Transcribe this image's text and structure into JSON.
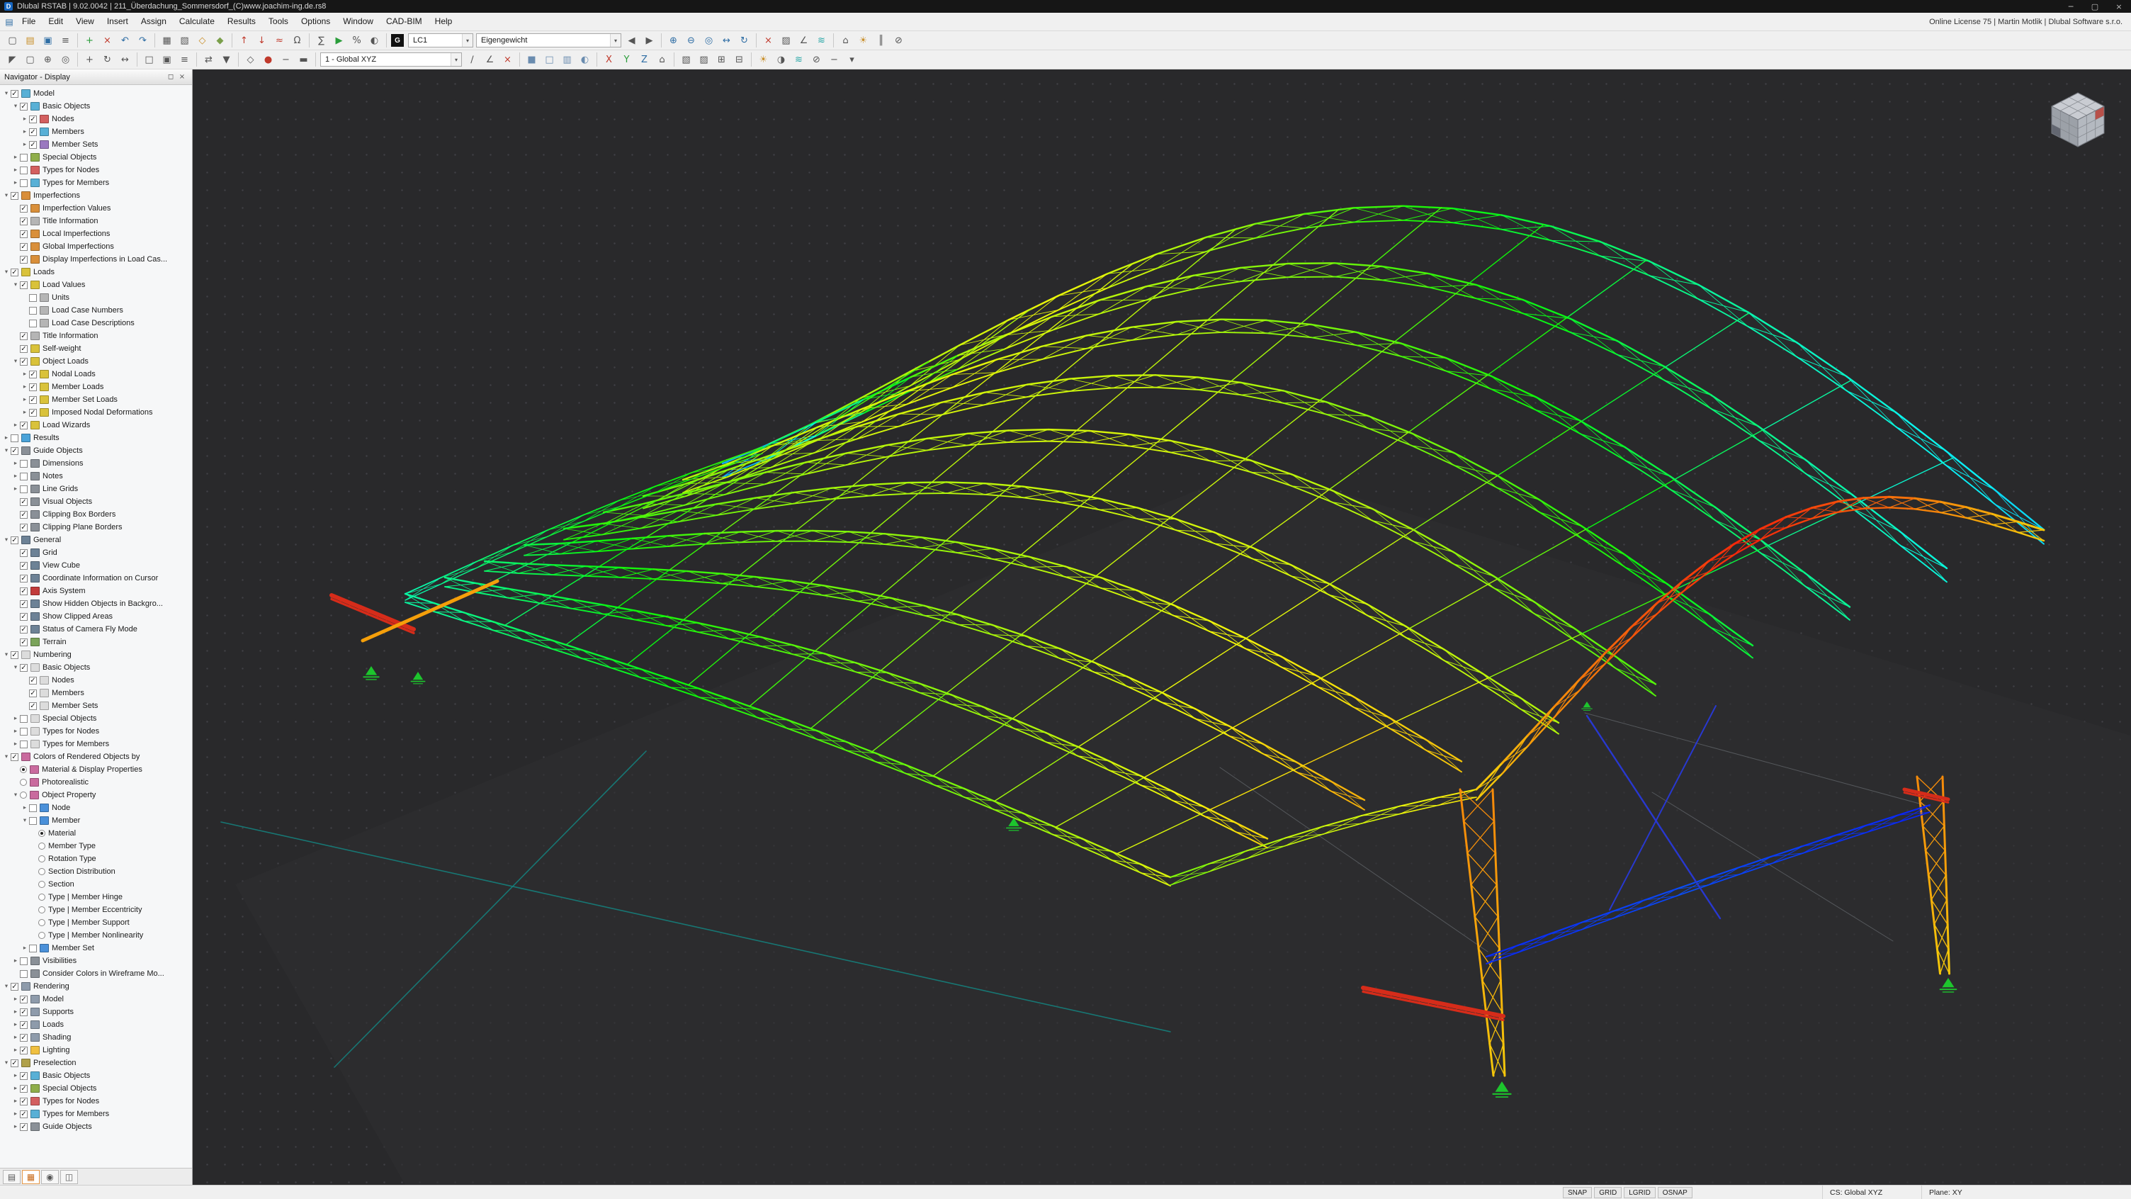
{
  "window": {
    "title": "Dlubal RSTAB | 9.02.0042 | 211_Überdachung_Sommersdorf_(C)www.joachim-ing.de.rs8",
    "license": "Online License 75 | Martin Motlik | Dlubal Software s.r.o.",
    "app_initial": "D",
    "minimize": "─",
    "maximize": "▢",
    "close": "×"
  },
  "menu": {
    "items": [
      "File",
      "Edit",
      "View",
      "Insert",
      "Assign",
      "Calculate",
      "Results",
      "Tools",
      "Options",
      "Window",
      "CAD-BIM",
      "Help"
    ]
  },
  "toolbar1": {
    "lc_tag": "G",
    "load_case": "LC1",
    "load_case_name": "Eigengewicht",
    "icons_a": [
      [
        "▢",
        "#555",
        "new-model"
      ],
      [
        "▤",
        "#c98f2a",
        "open-file"
      ],
      [
        "▣",
        "#2e6da4",
        "save"
      ],
      [
        "≡",
        "#555",
        "print"
      ],
      "|",
      [
        "+",
        "#2a9d3a",
        "add-object"
      ],
      [
        "×",
        "#c0392b",
        "delete-object"
      ],
      [
        "↶",
        "#2e6da4",
        "undo"
      ],
      [
        "↷",
        "#2e6da4",
        "redo"
      ],
      "|",
      [
        "▦",
        "#555",
        "tables"
      ],
      [
        "▧",
        "#555",
        "spreadsheet"
      ],
      [
        "◇",
        "#c98f2a",
        "materials"
      ],
      [
        "◆",
        "#7a9f4a",
        "sections"
      ],
      "|",
      [
        "↑",
        "#c0392b",
        "nodal-load"
      ],
      [
        "↓",
        "#c0392b",
        "member-load"
      ],
      [
        "≈",
        "#c0392b",
        "line-load"
      ],
      [
        "Ω",
        "#555",
        "imperfections"
      ],
      "|",
      [
        "∑",
        "#555",
        "load-combinations"
      ],
      [
        "▶",
        "#2a9d3a",
        "calculate-all"
      ],
      [
        "%",
        "#555",
        "calculation-parameters"
      ],
      [
        "◐",
        "#555",
        "results-toggle"
      ],
      "|"
    ],
    "icons_b": [
      [
        "◀",
        "#555",
        "previous-load-case"
      ],
      [
        "▶",
        "#555",
        "next-load-case"
      ],
      "|",
      [
        "⊕",
        "#2e6da4",
        "zoom-in"
      ],
      [
        "⊖",
        "#2e6da4",
        "zoom-out"
      ],
      [
        "◎",
        "#2e6da4",
        "zoom-extents"
      ],
      [
        "↔",
        "#2e6da4",
        "pan-view"
      ],
      [
        "↻",
        "#2e6da4",
        "rotate-view"
      ],
      "|",
      [
        "×",
        "#c0392b",
        "stop-calculation"
      ],
      [
        "▨",
        "#555",
        "result-diagrams"
      ],
      [
        "∠",
        "#555",
        "dimensioning"
      ],
      [
        "≋",
        "#2aa7a7",
        "deformations"
      ],
      "|",
      [
        "⌂",
        "#555",
        "home-view"
      ],
      [
        "☀",
        "#c98f2a",
        "lighting"
      ],
      [
        "║",
        "#555",
        "section-cut"
      ],
      [
        "⊘",
        "#555",
        "hide-objects"
      ]
    ]
  },
  "toolbar2": {
    "coordinate_system": "1 - Global XYZ",
    "icons_a": [
      [
        "◤",
        "#555",
        "select-pointer"
      ],
      [
        "▢",
        "#555",
        "box-select"
      ],
      [
        "⊕",
        "#555",
        "snap-settings"
      ],
      [
        "◎",
        "#555",
        "center-view"
      ],
      "|",
      [
        "+",
        "#555",
        "move-copy"
      ],
      [
        "↻",
        "#555",
        "rotate-copy"
      ],
      [
        "↔",
        "#555",
        "mirror"
      ],
      "|",
      [
        "□",
        "#555",
        "wireframe-mode"
      ],
      [
        "▣",
        "#555",
        "solid-mode"
      ],
      [
        "≡",
        "#555",
        "display-properties"
      ],
      "|",
      [
        "⇄",
        "#555",
        "toggle-tables"
      ],
      [
        "▼",
        "#555",
        "table-down"
      ],
      "|",
      [
        "◇",
        "#555",
        "points"
      ],
      [
        "●",
        "#c0392b",
        "nodes-display"
      ],
      [
        "−",
        "#555",
        "lines-display"
      ],
      [
        "▬",
        "#555",
        "members-display"
      ],
      "|"
    ],
    "icons_b": [
      [
        "∕",
        "#555",
        "draw-line"
      ],
      [
        "∠",
        "#555",
        "measure"
      ],
      [
        "×",
        "#c0392b",
        "delete"
      ],
      "|",
      [
        "■",
        "#6a8caf",
        "render-solid"
      ],
      [
        "□",
        "#6a8caf",
        "render-wireframe"
      ],
      [
        "▥",
        "#6a8caf",
        "render-hidden-line"
      ],
      [
        "◐",
        "#6a8caf",
        "render-shaded"
      ],
      "|",
      [
        "X",
        "#c0392b",
        "view-x"
      ],
      [
        "Y",
        "#2a9d3a",
        "view-y"
      ],
      [
        "Z",
        "#2e6da4",
        "view-z"
      ],
      [
        "⌂",
        "#555",
        "isometric-view"
      ],
      "|",
      [
        "▧",
        "#555",
        "clipping-box"
      ],
      [
        "▨",
        "#555",
        "clipping-plane"
      ],
      [
        "⊞",
        "#555",
        "grid-toggle"
      ],
      [
        "⊟",
        "#555",
        "work-plane"
      ],
      "|",
      [
        "☀",
        "#c98f2a",
        "light-toggle"
      ],
      [
        "◑",
        "#555",
        "shadow-toggle"
      ],
      [
        "≋",
        "#2aa7a7",
        "color-scale"
      ],
      [
        "⊘",
        "#555",
        "visibility-filter"
      ],
      [
        "−",
        "#555",
        "minimize-panel"
      ],
      [
        "▾",
        "#555",
        "more-options"
      ]
    ]
  },
  "navigator": {
    "title": "Navigator - Display",
    "pin_icon": "◻",
    "close_icon": "×",
    "tabs": [
      {
        "g": "▤",
        "n": "tab-data",
        "active": false
      },
      {
        "g": "▦",
        "n": "tab-display",
        "active": true
      },
      {
        "g": "◉",
        "n": "tab-views",
        "active": false
      },
      {
        "g": "◫",
        "n": "tab-results",
        "active": false
      }
    ],
    "tree": [
      [
        "Model",
        0,
        2,
        "c1",
        "#58b0d6"
      ],
      [
        "Basic Objects",
        1,
        2,
        "c1",
        "#58b0d6"
      ],
      [
        "Nodes",
        2,
        1,
        "c1",
        "#d35f5f"
      ],
      [
        "Members",
        2,
        1,
        "c1",
        "#58b0d6"
      ],
      [
        "Member Sets",
        2,
        1,
        "c1",
        "#9a78c0"
      ],
      [
        "Special Objects",
        1,
        1,
        "c0",
        "#8fae4a"
      ],
      [
        "Types for Nodes",
        1,
        1,
        "c0",
        "#d35f5f"
      ],
      [
        "Types for Members",
        1,
        1,
        "c0",
        "#58b0d6"
      ],
      [
        "Imperfections",
        0,
        2,
        "c1",
        "#d98f3a"
      ],
      [
        "Imperfection Values",
        1,
        0,
        "c1",
        "#d98f3a"
      ],
      [
        "Title Information",
        1,
        0,
        "c1",
        "#b5b5b5"
      ],
      [
        "Local Imperfections",
        1,
        0,
        "c1",
        "#d98f3a"
      ],
      [
        "Global Imperfections",
        1,
        0,
        "c1",
        "#d98f3a"
      ],
      [
        "Display Imperfections in Load Cas...",
        1,
        0,
        "c1",
        "#d98f3a"
      ],
      [
        "Loads",
        0,
        2,
        "c1",
        "#d9c23a"
      ],
      [
        "Load Values",
        1,
        2,
        "c1",
        "#d9c23a"
      ],
      [
        "Units",
        2,
        0,
        "c0",
        "#b5b5b5"
      ],
      [
        "Load Case Numbers",
        2,
        0,
        "c0",
        "#b5b5b5"
      ],
      [
        "Load Case Descriptions",
        2,
        0,
        "c0",
        "#b5b5b5"
      ],
      [
        "Title Information",
        1,
        0,
        "c1",
        "#b5b5b5"
      ],
      [
        "Self-weight",
        1,
        0,
        "c1",
        "#d9c23a"
      ],
      [
        "Object Loads",
        1,
        2,
        "c1",
        "#d9c23a"
      ],
      [
        "Nodal Loads",
        2,
        1,
        "c1",
        "#d9c23a"
      ],
      [
        "Member Loads",
        2,
        1,
        "c1",
        "#d9c23a"
      ],
      [
        "Member Set Loads",
        2,
        1,
        "c1",
        "#d9c23a"
      ],
      [
        "Imposed Nodal Deformations",
        2,
        1,
        "c1",
        "#d9c23a"
      ],
      [
        "Load Wizards",
        1,
        1,
        "c1",
        "#d9c23a"
      ],
      [
        "Results",
        0,
        1,
        "c0",
        "#4aa3d9"
      ],
      [
        "Guide Objects",
        0,
        2,
        "c1",
        "#8a9097"
      ],
      [
        "Dimensions",
        1,
        1,
        "c0",
        "#8a9097"
      ],
      [
        "Notes",
        1,
        1,
        "c0",
        "#8a9097"
      ],
      [
        "Line Grids",
        1,
        1,
        "c0",
        "#8a9097"
      ],
      [
        "Visual Objects",
        1,
        0,
        "c1",
        "#8a9097"
      ],
      [
        "Clipping Box Borders",
        1,
        0,
        "c1",
        "#8a9097"
      ],
      [
        "Clipping Plane Borders",
        1,
        0,
        "c1",
        "#8a9097"
      ],
      [
        "General",
        0,
        2,
        "c1",
        "#6d8296"
      ],
      [
        "Grid",
        1,
        0,
        "c1",
        "#6d8296"
      ],
      [
        "View Cube",
        1,
        0,
        "c1",
        "#6d8296"
      ],
      [
        "Coordinate Information on Cursor",
        1,
        0,
        "c1",
        "#6d8296"
      ],
      [
        "Axis System",
        1,
        0,
        "c1",
        "#c23b3b"
      ],
      [
        "Show Hidden Objects in Backgro...",
        1,
        0,
        "c1",
        "#6d8296"
      ],
      [
        "Show Clipped Areas",
        1,
        0,
        "c1",
        "#6d8296"
      ],
      [
        "Status of Camera Fly Mode",
        1,
        0,
        "c1",
        "#6d8296"
      ],
      [
        "Terrain",
        1,
        0,
        "c1",
        "#7aa35a"
      ],
      [
        "Numbering",
        0,
        2,
        "c1",
        "#dcdcdc"
      ],
      [
        "Basic Objects",
        1,
        2,
        "c1",
        "#dcdcdc"
      ],
      [
        "Nodes",
        2,
        0,
        "c1",
        "#dcdcdc"
      ],
      [
        "Members",
        2,
        0,
        "c1",
        "#dcdcdc"
      ],
      [
        "Member Sets",
        2,
        0,
        "c1",
        "#dcdcdc"
      ],
      [
        "Special Objects",
        1,
        1,
        "c0",
        "#dcdcdc"
      ],
      [
        "Types for Nodes",
        1,
        1,
        "c0",
        "#dcdcdc"
      ],
      [
        "Types for Members",
        1,
        1,
        "c0",
        "#dcdcdc"
      ],
      [
        "Colors of Rendered Objects by",
        0,
        2,
        "c1",
        "#c96a9e"
      ],
      [
        "Material & Display Properties",
        1,
        0,
        "r1",
        "#c96a9e"
      ],
      [
        "Photorealistic",
        1,
        0,
        "r0",
        "#c96a9e"
      ],
      [
        "Object Property",
        1,
        2,
        "r0",
        "#c96a9e"
      ],
      [
        "Node",
        2,
        1,
        "c0",
        "#4a90d9"
      ],
      [
        "Member",
        2,
        2,
        "c0",
        "#4a90d9"
      ],
      [
        "Material",
        3,
        0,
        "r1",
        null
      ],
      [
        "Member Type",
        3,
        0,
        "r0",
        null
      ],
      [
        "Rotation Type",
        3,
        0,
        "r0",
        null
      ],
      [
        "Section Distribution",
        3,
        0,
        "r0",
        null
      ],
      [
        "Section",
        3,
        0,
        "r0",
        null
      ],
      [
        "Type | Member Hinge",
        3,
        0,
        "r0",
        null
      ],
      [
        "Type | Member Eccentricity",
        3,
        0,
        "r0",
        null
      ],
      [
        "Type | Member Support",
        3,
        0,
        "r0",
        null
      ],
      [
        "Type | Member Nonlinearity",
        3,
        0,
        "r0",
        null
      ],
      [
        "Member Set",
        2,
        1,
        "c0",
        "#4a90d9"
      ],
      [
        "Visibilities",
        1,
        1,
        "c0",
        "#8a9097"
      ],
      [
        "Consider Colors in Wireframe Mo...",
        1,
        0,
        "c0",
        "#8a9097"
      ],
      [
        "Rendering",
        0,
        2,
        "c1",
        "#8e9bab"
      ],
      [
        "Model",
        1,
        1,
        "c1",
        "#8e9bab"
      ],
      [
        "Supports",
        1,
        1,
        "c1",
        "#8e9bab"
      ],
      [
        "Loads",
        1,
        1,
        "c1",
        "#8e9bab"
      ],
      [
        "Shading",
        1,
        1,
        "c1",
        "#8e9bab"
      ],
      [
        "Lighting",
        1,
        1,
        "c1",
        "#f0c040"
      ],
      [
        "Preselection",
        0,
        2,
        "c1",
        "#b0a14a"
      ],
      [
        "Basic Objects",
        1,
        1,
        "c1",
        "#58b0d6"
      ],
      [
        "Special Objects",
        1,
        1,
        "c1",
        "#8fae4a"
      ],
      [
        "Types for Nodes",
        1,
        1,
        "c1",
        "#d35f5f"
      ],
      [
        "Types for Members",
        1,
        1,
        "c1",
        "#58b0d6"
      ],
      [
        "Guide Objects",
        1,
        1,
        "c1",
        "#8a9097"
      ]
    ]
  },
  "statusbar": {
    "toggles": [
      "SNAP",
      "GRID",
      "LGRID",
      "OSNAP"
    ],
    "cs": "CS: Global XYZ",
    "plane": "Plane: XY"
  },
  "scene": {
    "background": "#29292b",
    "dot_color": "#414146",
    "terrain_color": "#2e2e31",
    "guide_color": "#15807c",
    "support_color": "#1dc52d",
    "red_color": "#d62c1a",
    "blue_color": "#2838d0",
    "cable_color": "#55585c",
    "truss_stops": [
      [
        0.32,
        0.45,
        0.55,
        0.62,
        0.72
      ],
      [
        0.34,
        0.5,
        0.6,
        0.68,
        0.78
      ],
      [
        0.38,
        0.55,
        0.63,
        0.72,
        0.82
      ],
      [
        0.42,
        0.6,
        0.66,
        0.74,
        0.8
      ],
      [
        0.5,
        0.65,
        0.7,
        0.72,
        0.68
      ],
      [
        0.55,
        0.68,
        0.72,
        0.68,
        0.58
      ],
      [
        0.6,
        0.72,
        0.7,
        0.6,
        0.45
      ],
      [
        0.68,
        0.74,
        0.66,
        0.5,
        0.35
      ],
      [
        0.08,
        0.72,
        0.62,
        0.45,
        0.28
      ],
      [
        0.6,
        0.75,
        0.55,
        0.35,
        0.22
      ]
    ],
    "arch_stops": [
      0.78,
      0.9,
      0.97,
      0.9,
      0.8
    ],
    "column_stops": [
      0.87,
      0.84,
      0.8
    ],
    "brace_stops": [
      0.03,
      0.05,
      0.07,
      0.05,
      0.03
    ]
  }
}
